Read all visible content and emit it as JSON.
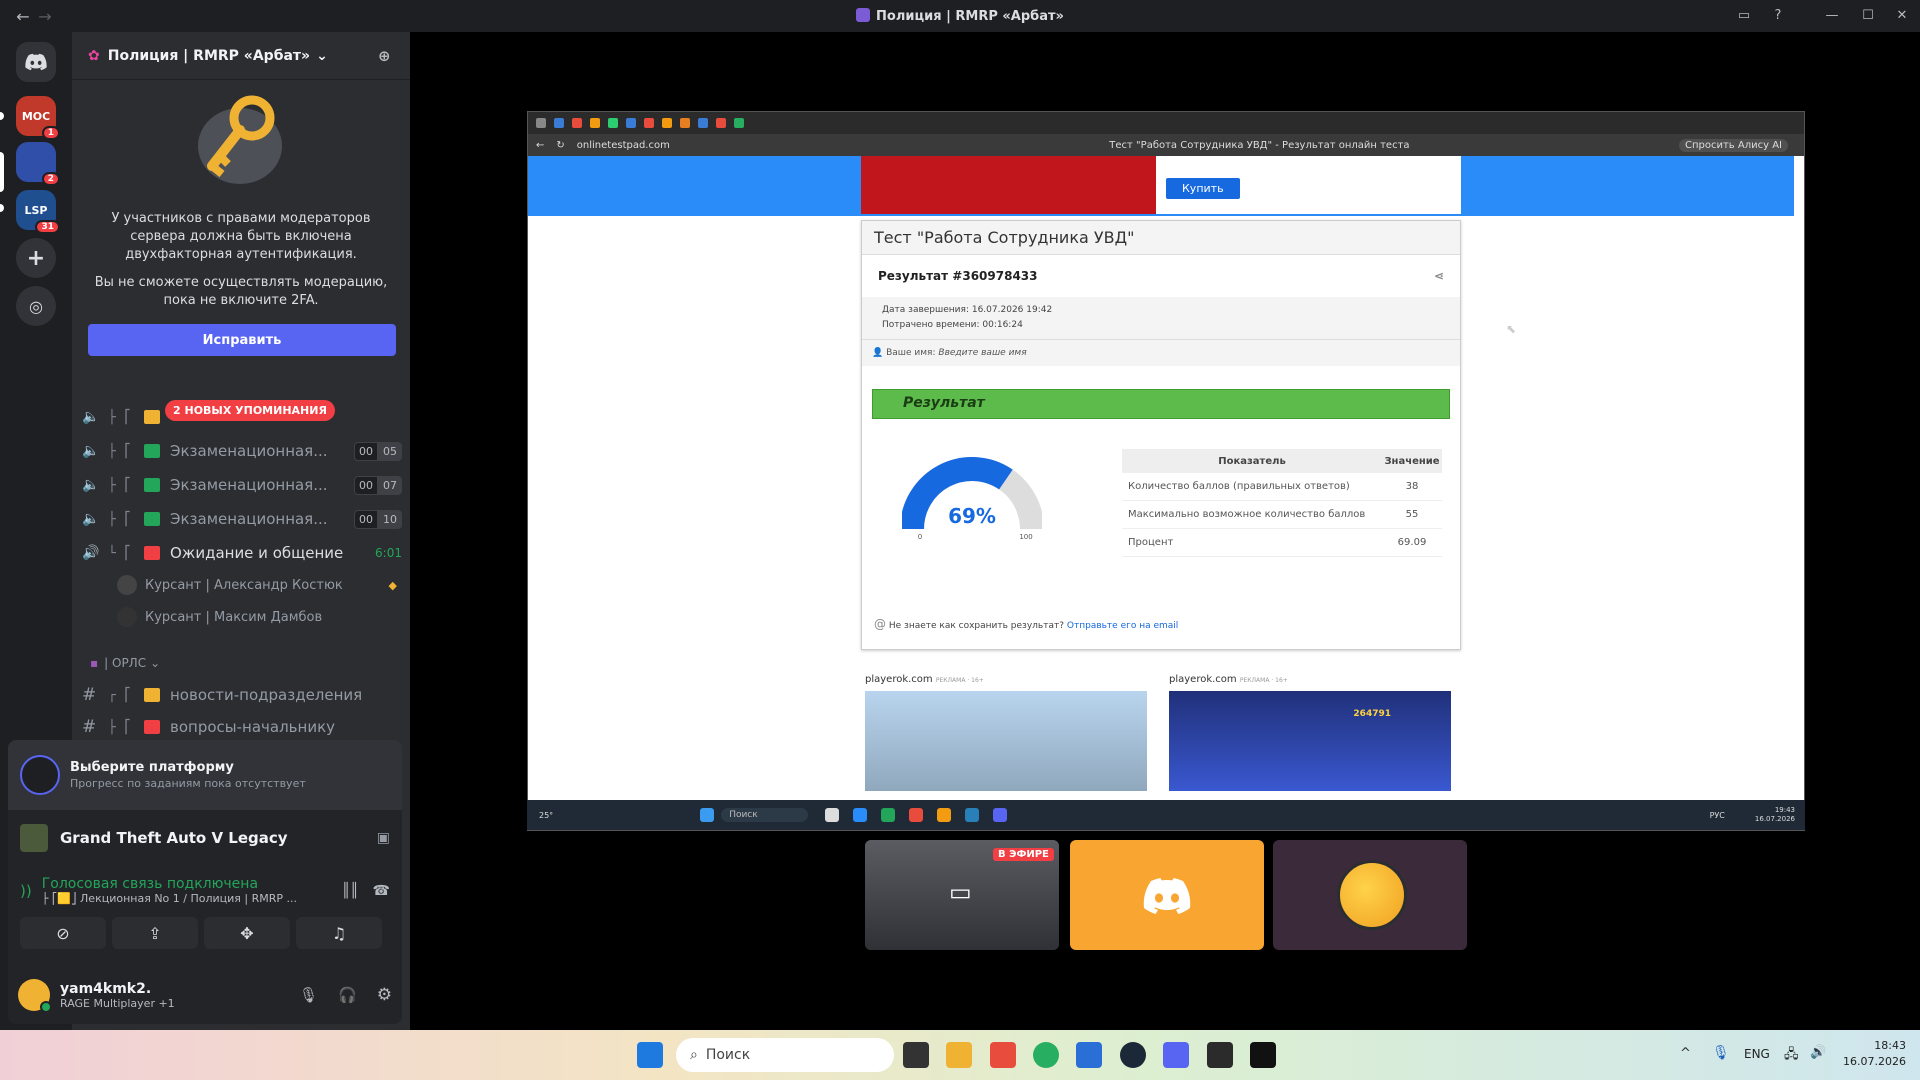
{
  "window": {
    "title": "Полиция | RMRP «Арбат»"
  },
  "server": {
    "name": "Полиция | RMRP «Арбат»"
  },
  "server_list": [
    {
      "label": "МОС",
      "badge": "1"
    },
    {
      "label": "",
      "badge": "2"
    },
    {
      "label": "LSP",
      "badge": "31"
    }
  ],
  "mod_notice": {
    "line1": "У участников с правами модераторов сервера должна быть включена двухфакторная аутентификация.",
    "line2": "Вы не сможете осуществлять модерацию, пока не включите 2FA.",
    "button": "Исправить"
  },
  "mention_badge": "2 НОВЫХ УПОМИНАНИЯ",
  "channels": [
    {
      "name": "Экзаменационная...",
      "c1": "00",
      "c2": "05"
    },
    {
      "name": "Экзаменационная...",
      "c1": "00",
      "c2": "07"
    },
    {
      "name": "Экзаменационная...",
      "c1": "00",
      "c2": "10"
    },
    {
      "name": "Ожидание и общение",
      "timer": "6:01"
    }
  ],
  "members": [
    "Курсант | Александр Костюк",
    "Курсант | Максим Дамбов"
  ],
  "category": "| ОРЛС",
  "text_channels": [
    "новости-подразделения",
    "вопросы-начальнику"
  ],
  "activity": {
    "title": "Выберите платформу",
    "subtitle": "Прогресс по заданиям пока отсутствует"
  },
  "game": "Grand Theft Auto V Legacy",
  "voice": {
    "status": "Голосовая связь подключена",
    "channel": "├ ⎡🟨⎦ Лекционная No 1 / Полиция | RMRP ..."
  },
  "user": {
    "name": "yam4kmk2.",
    "status": "RAGE Multiplayer +1"
  },
  "browser": {
    "url": "onlinetestpad.com",
    "page_title": "Тест \"Работа Сотрудника УВД\" - Результат онлайн теста",
    "alice": "Спросить Алису AI",
    "buy": "Купить",
    "test_title": "Тест \"Работа Сотрудника УВД\"",
    "result_id": "Результат #360978433",
    "finish_label": "Дата завершения:",
    "finish_value": "16.07.2026 19:42",
    "spent_label": "Потрачено времени:",
    "spent_value": "00:16:24",
    "name_label": "Ваше имя:",
    "name_value": "Введите ваше имя",
    "result_label": "Результат",
    "gauge_pct": "69%",
    "gauge_value": 69.09,
    "gauge_min": "0",
    "gauge_max": "100",
    "stats_head": [
      "Показатель",
      "Значение"
    ],
    "stats": [
      [
        "Количество баллов (правильных ответов)",
        "38"
      ],
      [
        "Максимально возможное количество баллов",
        "55"
      ],
      [
        "Процент",
        "69.09"
      ]
    ],
    "save_q": "Не знаете как сохранить результат?",
    "save_link": "Отправьте его на email",
    "ad_source": "playerok.com",
    "ad_label": "РЕКЛАМА · 16+",
    "ad_number": "264791",
    "tb_search": "Поиск",
    "tb_temp": "25°",
    "tb_lang": "РУС",
    "tb_time": "19:43",
    "tb_date": "16.07.2026"
  },
  "live_badge": "В ЭФИРЕ",
  "win_taskbar": {
    "search": "Поиск",
    "lang": "ENG",
    "time": "18:43",
    "date": "16.07.2026"
  }
}
